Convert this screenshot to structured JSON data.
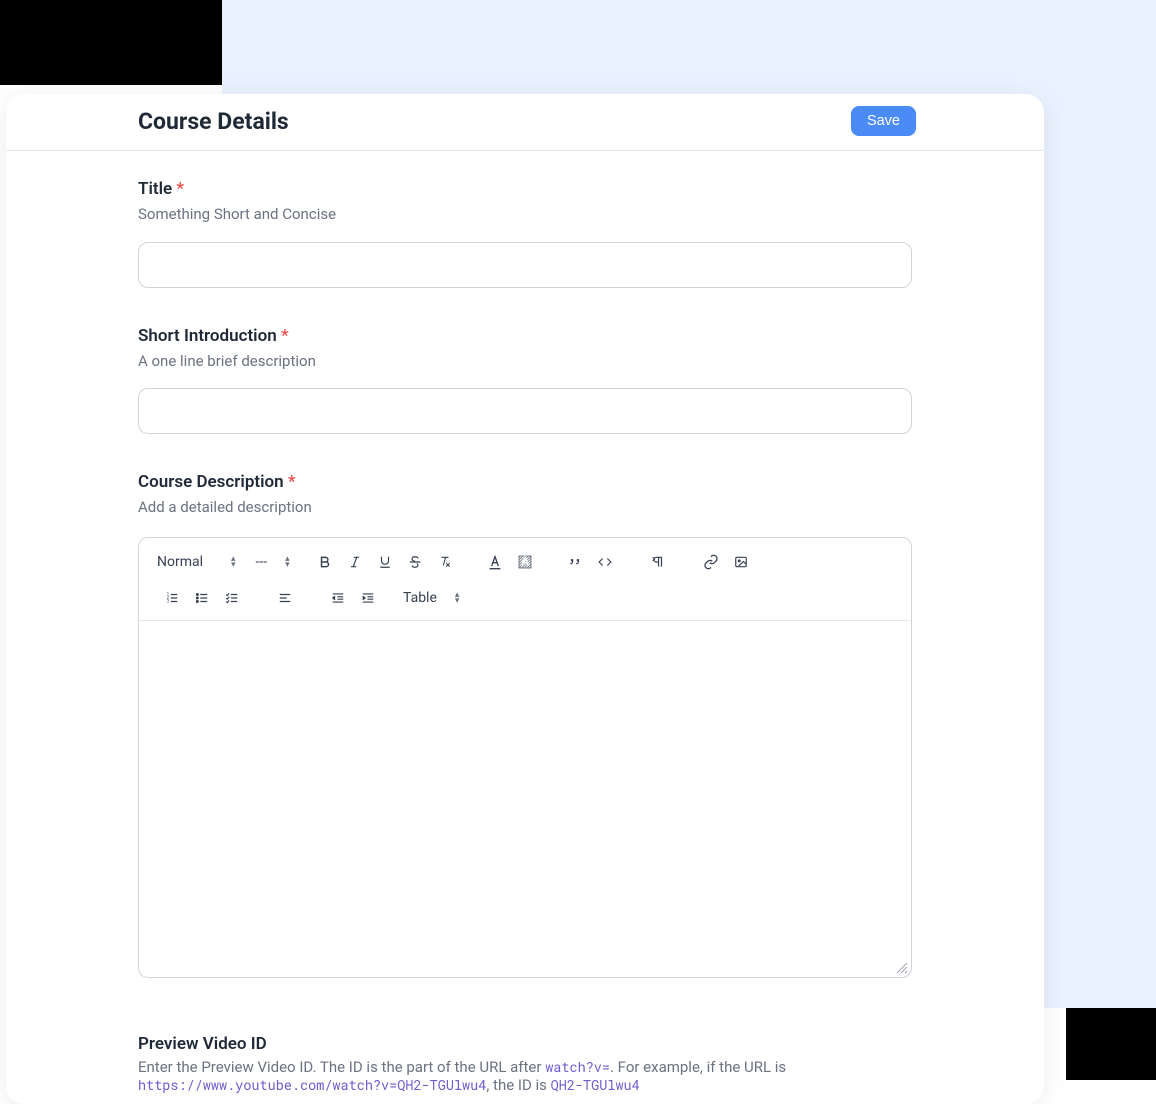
{
  "page": {
    "title": "Course Details",
    "save_button": "Save"
  },
  "fields": {
    "title": {
      "label": "Title",
      "required_marker": "*",
      "helper": "Something Short and Concise",
      "value": ""
    },
    "short_intro": {
      "label": "Short Introduction",
      "required_marker": "*",
      "helper": "A one line brief description",
      "value": ""
    },
    "course_desc": {
      "label": "Course Description",
      "required_marker": "*",
      "helper": "Add a detailed description",
      "value": ""
    },
    "preview_video": {
      "label": "Preview Video ID",
      "helper_pre": "Enter the Preview Video ID. The ID is the part of the URL after ",
      "code1": "watch?v=",
      "helper_mid1": ". For example, if the URL is ",
      "code2": "https://www.youtube.com/watch?v=QH2-TGUlwu4",
      "helper_mid2": ", the ID is ",
      "code3": "QH2-TGUlwu4"
    }
  },
  "editor_toolbar": {
    "heading_select": "Normal",
    "size_select": "---",
    "table_select": "Table"
  }
}
